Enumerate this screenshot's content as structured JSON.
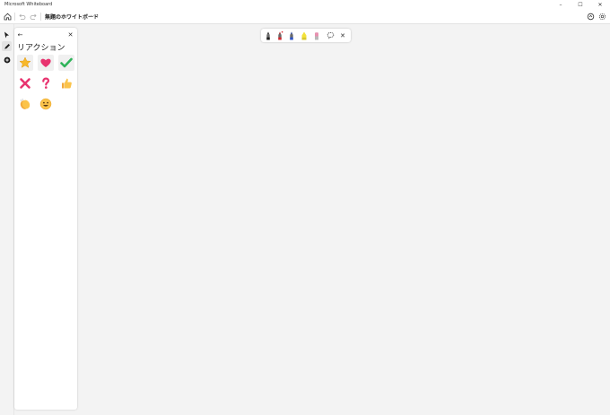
{
  "window": {
    "title": "Microsoft Whiteboard",
    "minimize_glyph": "–",
    "maximize_glyph": "☐",
    "close_glyph": "✕"
  },
  "toolbar": {
    "home_icon": "home-icon",
    "undo_icon": "undo-icon",
    "redo_icon": "redo-icon",
    "board_title": "無題のホワイトボード",
    "board_title_chevron": "⌵",
    "share_icon": "share-icon",
    "settings_icon": "gear-icon"
  },
  "left_rail": {
    "items": [
      {
        "name": "select-tool",
        "icon": "pointer-icon"
      },
      {
        "name": "ink-tool",
        "icon": "pen-icon"
      },
      {
        "name": "add-tool",
        "icon": "plus-circle-icon"
      }
    ]
  },
  "reactions_panel": {
    "back_glyph": "←",
    "close_glyph": "✕",
    "title": "リアクション",
    "items": [
      {
        "name": "star-reaction",
        "icon": "star-icon"
      },
      {
        "name": "heart-reaction",
        "icon": "heart-icon"
      },
      {
        "name": "check-reaction",
        "icon": "check-icon"
      },
      {
        "name": "cross-reaction",
        "icon": "cross-icon"
      },
      {
        "name": "question-reaction",
        "icon": "question-icon"
      },
      {
        "name": "thumbs-up-reaction",
        "icon": "thumbs-up-icon"
      },
      {
        "name": "clap-reaction",
        "icon": "clap-icon"
      },
      {
        "name": "smile-reaction",
        "icon": "smile-icon"
      }
    ]
  },
  "ink_toolbar": {
    "pens": [
      {
        "name": "black-pen",
        "color": "#1f1f1f"
      },
      {
        "name": "red-pen",
        "color": "#d6262d"
      },
      {
        "name": "blue-pen",
        "color": "#2f55c9"
      },
      {
        "name": "highlighter",
        "color": "#f3e23a"
      },
      {
        "name": "eraser",
        "color": "#e891b0"
      }
    ],
    "lasso_icon": "lasso-icon",
    "close_glyph": "✕"
  }
}
